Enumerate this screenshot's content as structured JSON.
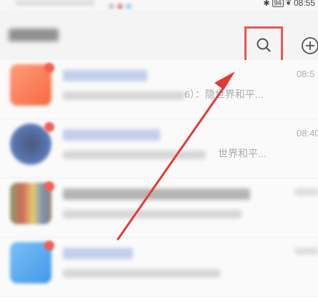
{
  "status": {
    "battery": "94",
    "time": "08:55"
  },
  "header": {
    "search_icon": "search-icon",
    "add_icon": "plus-circle-icon"
  },
  "chats": [
    {
      "preview_snippet": "6）：隐世界和平...",
      "time": "08:5"
    },
    {
      "preview_snippet": "世界和平...",
      "time": "08:40"
    },
    {
      "preview_snippet": "",
      "time": ""
    },
    {
      "preview_snippet": "",
      "time": ""
    }
  ],
  "colors": {
    "highlight": "#e53935",
    "badge": "#f44336"
  }
}
